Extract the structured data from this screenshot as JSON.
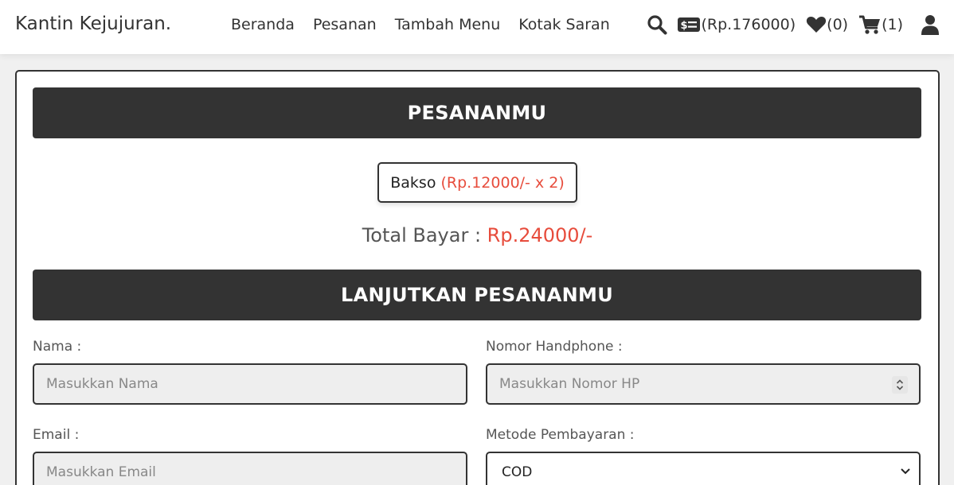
{
  "header": {
    "logo": "Kantin Kejujuran",
    "logo_dot": ".",
    "nav": [
      "Beranda",
      "Pesanan",
      "Tambah Menu",
      "Kotak Saran"
    ],
    "balance": "(Rp.176000)",
    "wishlist_count": "(0)",
    "cart_count": "(1)"
  },
  "order": {
    "title": "PESANANMU",
    "item_name": "Bakso",
    "item_detail": "(Rp.12000/- x 2)",
    "total_label": "Total Bayar :",
    "total_value": "Rp.24000/-"
  },
  "checkout": {
    "title": "LANJUTKAN PESANANMU",
    "name_label": "Nama :",
    "name_placeholder": "Masukkan Nama",
    "phone_label": "Nomor Handphone :",
    "phone_placeholder": "Masukkan Nomor HP",
    "email_label": "Email :",
    "email_placeholder": "Masukkan Email",
    "payment_label": "Metode Pembayaran :",
    "payment_selected": "COD"
  },
  "colors": {
    "dark": "#333333",
    "accent_red": "#e74c3c"
  },
  "icons": [
    "search-icon",
    "money-card-icon",
    "heart-icon",
    "cart-icon",
    "user-icon"
  ]
}
